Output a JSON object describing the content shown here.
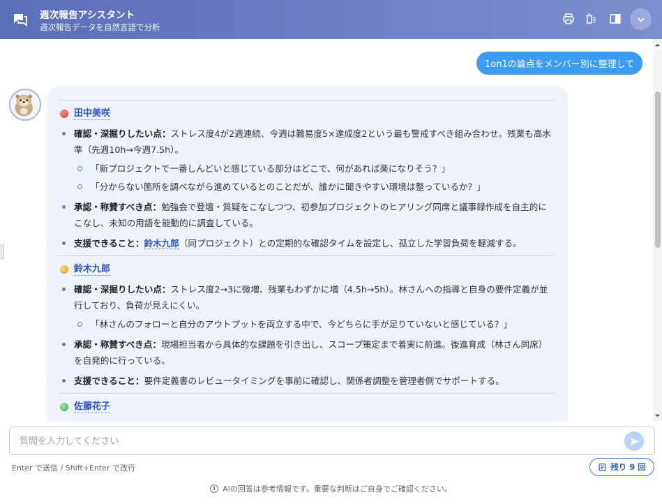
{
  "header": {
    "title": "週次報告アシスタント",
    "subtitle": "週次報告データを自然言語で分析"
  },
  "chat": {
    "user_message": "1on1の論点をメンバー別に整理して",
    "members": [
      {
        "name": "田中美咲",
        "color": "#d8323a",
        "confirm_label": "確認・深掘りしたい点：",
        "confirm_text": "ストレス度4が2週連続、今週は難易度5×達成度2という最も警戒すべき組み合わせ。残業も高水準（先週10h→今週7.5h）。",
        "questions": [
          "「新プロジェクトで一番しんどいと感じている部分はどこで、何があれば楽になりそう？」",
          "「分からない箇所を調べながら進めているとのことだが、誰かに聞きやすい環境は整っているか？」"
        ],
        "praise_label": "承認・称賛すべき点：",
        "praise_text": "勉強会で登壇・質疑をこなしつつ、初参加プロジェクトのヒアリング同席と議事録作成を自主的にこなし、未知の用語を能動的に調査している。",
        "support_label": "支援できること：",
        "support_link": "鈴木九郎",
        "support_text": "（同プロジェクト）との定期的な確認タイムを設定し、孤立した学習負荷を軽減する。"
      },
      {
        "name": "鈴木九郎",
        "color": "#e09a1e",
        "confirm_label": "確認・深掘りしたい点：",
        "confirm_text": "ストレス度2→3に微増、残業もわずかに増（4.5h→5h）。林さんへの指導と自身の要件定義が並行しており、負荷が見えにくい。",
        "questions": [
          "「林さんのフォローと自分のアウトプットを両立する中で、今どちらに手が足りていないと感じている？」"
        ],
        "praise_label": "承認・称賛すべき点：",
        "praise_text": "現場担当者から具体的な課題を引き出し、スコープ策定まで着実に前進。後進育成（林さん同席）を自発的に行っている。",
        "support_label": "支援できること：",
        "support_text": "要件定義書のレビュータイミングを事前に確認し、関係者調整を管理者側でサポートする。"
      },
      {
        "name": "佐藤花子",
        "color": "#3aa85a"
      }
    ]
  },
  "input": {
    "placeholder": "質問を入力してください",
    "hint": "Enter で送信 / Shift+Enter で改行",
    "remaining_label": "残り 9 回"
  },
  "footer": {
    "disclaimer": "AIの回答は参考情報です。重要な判断はご自身でご確認ください。"
  }
}
